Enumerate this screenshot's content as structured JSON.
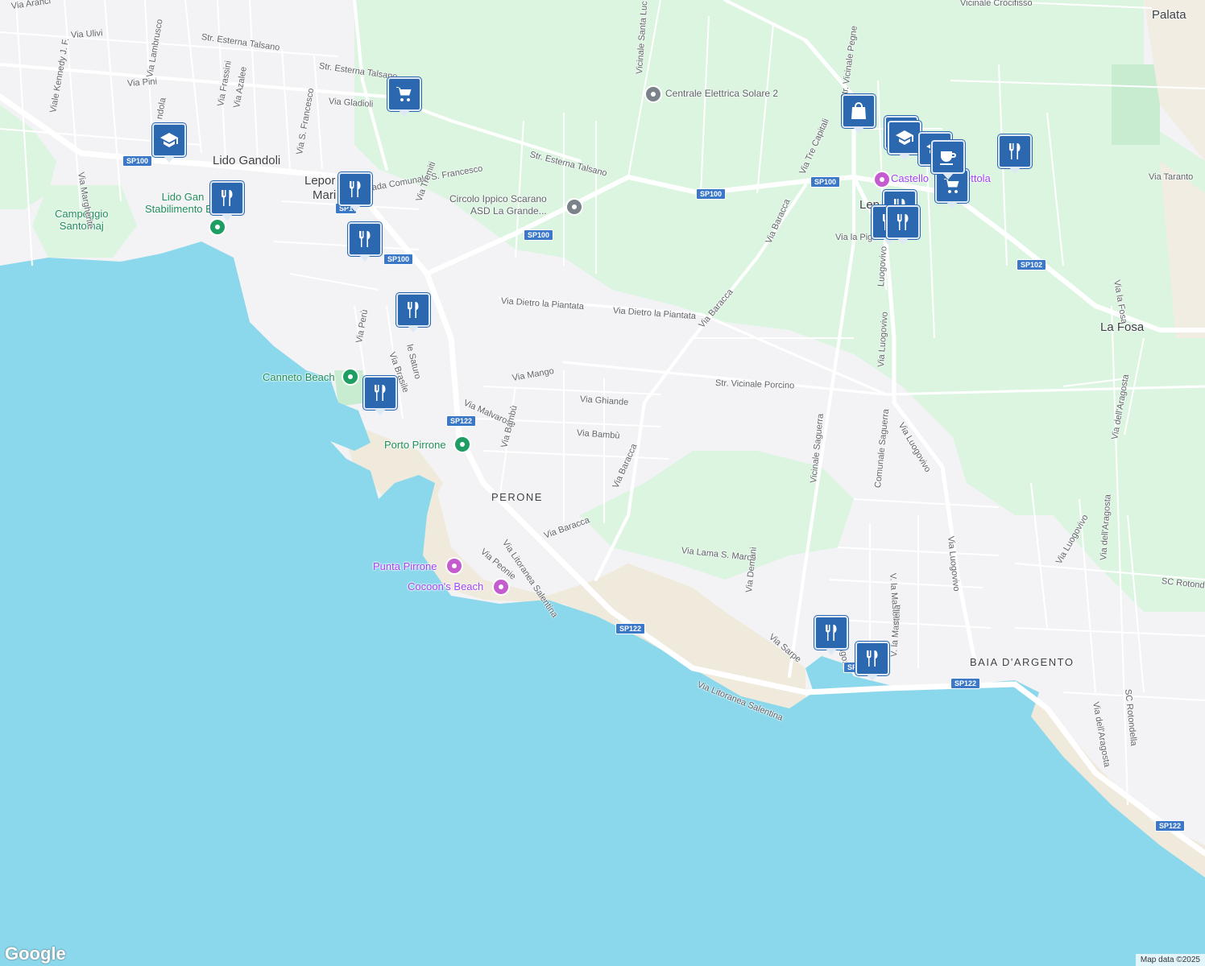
{
  "colors": {
    "sea": "#8bd8ec",
    "land": "#f3f3f5",
    "green": "#dbf5e0",
    "sand": "#f1ede3",
    "road": "#ffffff",
    "poi": "#2b68b0",
    "shield": "#3b78c7"
  },
  "places": {
    "lido_gandoli": "Lido Gandoli",
    "palata": "Palata",
    "la_fosa": "La Fosa",
    "perone": "PERONE",
    "baia_argento": "BAIA D'ARGENTO",
    "leporano_marina_1": "Lepor",
    "leporano_marina_2": "Mari",
    "leporano": "Lep"
  },
  "pois": {
    "campeggio": "Campeggio\nSantomaj",
    "lido_gandoli_stab": "Lido Gan\nStabilimento Bal",
    "canneto": "Canneto Beach",
    "porto_pirrone": "Porto Pirrone",
    "punta_pirrone": "Punta Pirrone",
    "cocoons": "Cocoon's Beach",
    "centrale": "Centrale Elettrica Solare 2",
    "circolo": "Circolo Ippico Scarano\nASD La Grande...",
    "castello": "Castello",
    "castello_tail": "ettola"
  },
  "roads": {
    "via_aranci": "Via Aranci",
    "via_ulivi": "Via Ulivi",
    "via_lambrusco": "Via Lambrusco",
    "via_pini": "Via Pini",
    "str_esterna_talsano_1": "Str. Esterna Talsano",
    "str_esterna_talsano_2": "Str. Esterna Talsano",
    "str_esterna_talsano_3": "Str. Esterna Talsano",
    "via_gladioli": "Via Gladioli",
    "viale_kennedy": "Viale Kennedy J. F.",
    "via_frassini": "Via Frassini",
    "via_azalee": "Via Azalee",
    "via_s_francesco": "Via S. Francesco",
    "strada_comunale": "Strada Comunale S. Francesco",
    "via_tremiti": "Via Tremiti",
    "via_margherite": "Via Margherite",
    "gandola": "ndola",
    "vicinale_santa_lucia": "Vicinale Santa Luc",
    "vicinale_crocifisso": "Vicinale Crocifisso",
    "str_vicinale_pegne": "Str. Vicinale Pegne",
    "via_tre_capitali": "Via Tre Capitali",
    "via_baracca_1": "Via Baracca",
    "via_baracca_2": "Via Baracca",
    "via_baracca_3": "Via Baracca",
    "via_baracca_4": "Via Baracca",
    "via_la_pigna": "Via la Pigna",
    "via_luogovivo_1": "Via Luogovivo",
    "via_luogovivo_2": "Via Luogovivo",
    "via_luogovivo_3": "Via Luogovivo",
    "via_luogovivo_4": "Via Luogovivo",
    "luogovivo_short": "Luogovivo",
    "via_taranto": "Via Taranto",
    "via_la_fosa": "Via la Fosa",
    "via_aragosta_1": "Via dell'Aragosta",
    "via_aragosta_2": "Via dell'Aragosta",
    "via_aragosta_3": "Via dell'Aragosta",
    "via_dietro_1": "Via Dietro la Piantata",
    "via_dietro_2": "Via Dietro la Piantata",
    "str_vicinale_porcino": "Str. Vicinale Porcino",
    "via_mango": "Via Mango",
    "via_ghiande": "Via Ghiande",
    "via_malvarose": "Via Malvarose",
    "via_bambu_1": "Via Bambù",
    "via_bambu_2": "Via Bambù",
    "via_peru": "Via Perù",
    "via_brasile": "Via Brasile",
    "via_saturo": "le Saturo",
    "via_litoranea_1": "Via Litoranea Salentina",
    "via_litoranea_2": "Via Litoranea Salentina",
    "via_peonie": "Via Peonie",
    "via_lama": "Via Lama S. Marco",
    "vicinale_saguerra": "Vicinale Saguerra",
    "comunale_saguerra": "Comunale Saguerra",
    "via_mastella_1": "V. la Mastella",
    "via_mastella_2": "V. la Mastella",
    "via_demani": "Via Demani",
    "via_pitagora": "Via Pitagora",
    "via_sarpe": "Via Sarpe",
    "sc_rotondella_1": "SC Rotonde",
    "sc_rotondella_2": "SC Rotondella"
  },
  "shields": {
    "sp100": "SP100",
    "sp102": "SP102",
    "sp122": "SP122",
    "sp1_partial": "SP1",
    "sp_partial": "SP"
  },
  "icons": [
    "shopping-cart-icon",
    "graduation-cap-icon",
    "restaurant-icon",
    "shopping-bag-icon",
    "coffee-icon",
    "camera-icon",
    "museum-icon",
    "park-icon"
  ],
  "attribution": "Map data ©2025",
  "logo": "Google"
}
